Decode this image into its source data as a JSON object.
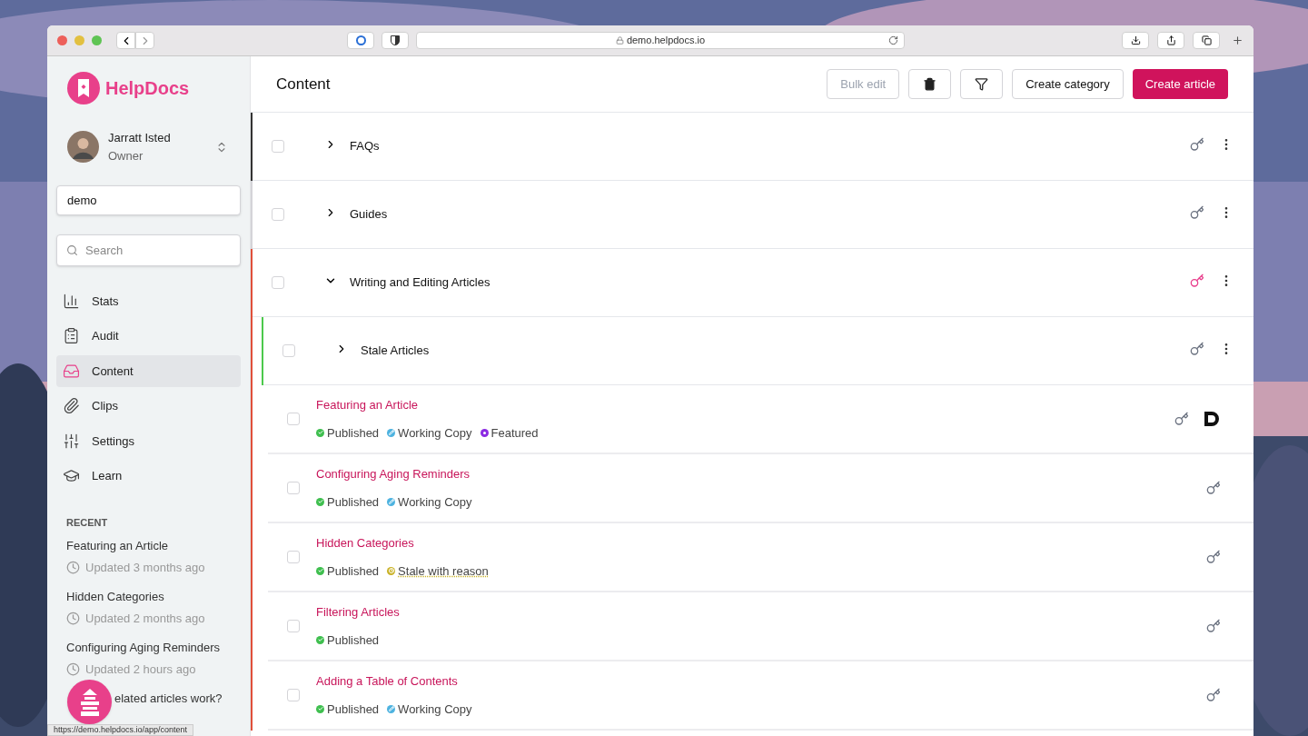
{
  "browser": {
    "url": "demo.helpdocs.io"
  },
  "sidebar": {
    "brand": "HelpDocs",
    "user": {
      "name": "Jarratt Isted",
      "role": "Owner"
    },
    "workspace": {
      "value": "demo"
    },
    "search": {
      "placeholder": "Search"
    },
    "nav": [
      {
        "label": "Stats",
        "selected": false
      },
      {
        "label": "Audit",
        "selected": false
      },
      {
        "label": "Content",
        "selected": true
      },
      {
        "label": "Clips",
        "selected": false
      },
      {
        "label": "Settings",
        "selected": false
      },
      {
        "label": "Learn",
        "selected": false
      }
    ],
    "recent_heading": "RECENT",
    "recent": [
      {
        "title": "Featuring an Article",
        "updated": "Updated 3 months ago"
      },
      {
        "title": "Hidden Categories",
        "updated": "Updated 2 months ago"
      },
      {
        "title": "Configuring Aging Reminders",
        "updated": "Updated 2 hours ago"
      },
      {
        "title": "elated articles work?"
      }
    ]
  },
  "status_url": "https://demo.helpdocs.io/app/content",
  "content": {
    "title": "Content",
    "actions": [
      {
        "label": "Bulk edit",
        "kind": "disabled"
      },
      {
        "kind": "trash"
      },
      {
        "kind": "filter"
      },
      {
        "label": "Create category",
        "kind": "outline"
      },
      {
        "label": "Create article",
        "kind": "primary"
      }
    ],
    "items": [
      {
        "kind": "category",
        "title": "FAQs",
        "color": "#333333",
        "checked": false,
        "expanded": false,
        "key_active": false
      },
      {
        "kind": "category",
        "title": "Guides",
        "color": "#d4d4d8",
        "checked": false,
        "expanded": false,
        "key_active": false
      },
      {
        "kind": "category",
        "title": "Writing and Editing Articles",
        "color": "#e0503a",
        "checked": false,
        "expanded": true,
        "key_active": true,
        "children": [
          {
            "kind": "category",
            "title": "Stale Articles",
            "color": "#4cc94c",
            "checked": false,
            "expanded": false,
            "key_active": false
          },
          {
            "kind": "article",
            "title": "Featuring an Article",
            "checked": false,
            "logo": true,
            "statuses": [
              {
                "label": "Published",
                "kind": "published"
              },
              {
                "label": "Working Copy",
                "kind": "working"
              },
              {
                "label": "Featured",
                "kind": "featured"
              }
            ]
          },
          {
            "kind": "article",
            "title": "Configuring Aging Reminders",
            "checked": false,
            "logo": false,
            "statuses": [
              {
                "label": "Published",
                "kind": "published"
              },
              {
                "label": "Working Copy",
                "kind": "working"
              }
            ]
          },
          {
            "kind": "article",
            "title": "Hidden Categories",
            "checked": false,
            "logo": false,
            "statuses": [
              {
                "label": "Published",
                "kind": "published"
              },
              {
                "label": "Stale with reason",
                "kind": "stale"
              }
            ]
          },
          {
            "kind": "article",
            "title": "Filtering Articles",
            "checked": false,
            "logo": false,
            "statuses": [
              {
                "label": "Published",
                "kind": "published"
              }
            ]
          },
          {
            "kind": "article",
            "title": "Adding a Table of Contents",
            "checked": false,
            "logo": false,
            "statuses": [
              {
                "label": "Published",
                "kind": "published"
              },
              {
                "label": "Working Copy",
                "kind": "working"
              }
            ]
          }
        ]
      }
    ]
  }
}
